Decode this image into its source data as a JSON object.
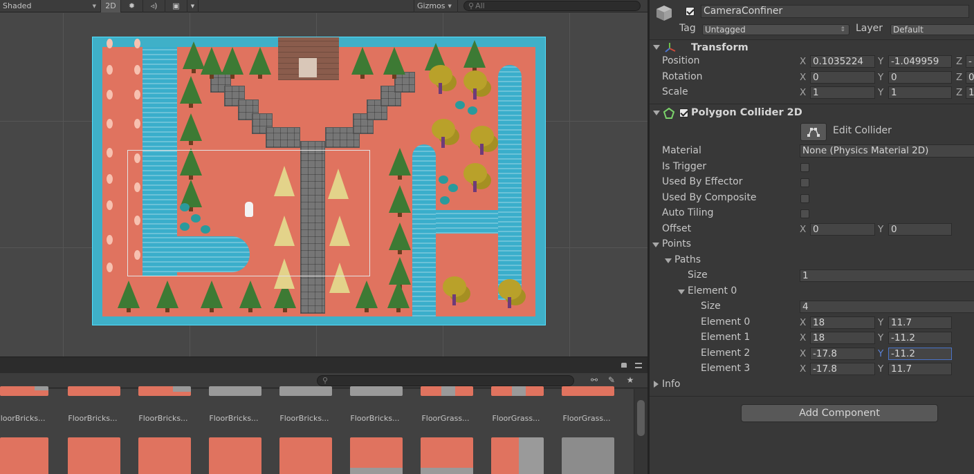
{
  "scene": {
    "toolbar": {
      "shading_mode": "Shaded",
      "mode_2d": "2D",
      "gizmos": "Gizmos",
      "search_placeholder": "All"
    }
  },
  "project": {
    "search_placeholder": "",
    "assets_row1": [
      {
        "label": "FloorBricks..."
      },
      {
        "label": "FloorBricks..."
      },
      {
        "label": "FloorBricks..."
      },
      {
        "label": "FloorBricks..."
      },
      {
        "label": "FloorBricks..."
      },
      {
        "label": "FloorBricks..."
      },
      {
        "label": "FloorGrass..."
      },
      {
        "label": "FloorGrass..."
      },
      {
        "label": "FloorGrass..."
      }
    ]
  },
  "inspector": {
    "object": {
      "name": "CameraConfiner",
      "active": true,
      "tag_label": "Tag",
      "tag_value": "Untagged",
      "layer_label": "Layer",
      "layer_value": "Default"
    },
    "transform": {
      "title": "Transform",
      "position_label": "Position",
      "position": {
        "x": "0.1035224",
        "y": "-1.049959",
        "z": "-"
      },
      "rotation_label": "Rotation",
      "rotation": {
        "x": "0",
        "y": "0",
        "z": "0"
      },
      "scale_label": "Scale",
      "scale": {
        "x": "1",
        "y": "1",
        "z": "1"
      }
    },
    "polygon_collider": {
      "title": "Polygon Collider 2D",
      "enabled": true,
      "edit_collider": "Edit Collider",
      "material_label": "Material",
      "material_value": "None (Physics Material 2D)",
      "is_trigger_label": "Is Trigger",
      "used_by_effector_label": "Used By Effector",
      "used_by_composite_label": "Used By Composite",
      "auto_tiling_label": "Auto Tiling",
      "offset_label": "Offset",
      "offset": {
        "x": "0",
        "y": "0"
      },
      "points_label": "Points",
      "paths_label": "Paths",
      "paths_size_label": "Size",
      "paths_size": "1",
      "element0_label": "Element 0",
      "element0_size_label": "Size",
      "element0_size": "4",
      "points": [
        {
          "label": "Element 0",
          "x": "18",
          "y": "11.7"
        },
        {
          "label": "Element 1",
          "x": "18",
          "y": "-11.2"
        },
        {
          "label": "Element 2",
          "x": "-17.8",
          "y": "-11.2"
        },
        {
          "label": "Element 3",
          "x": "-17.8",
          "y": "11.7"
        }
      ],
      "info_label": "Info"
    },
    "add_component": "Add Component",
    "axis_labels": {
      "x": "X",
      "y": "Y",
      "z": "Z"
    }
  }
}
